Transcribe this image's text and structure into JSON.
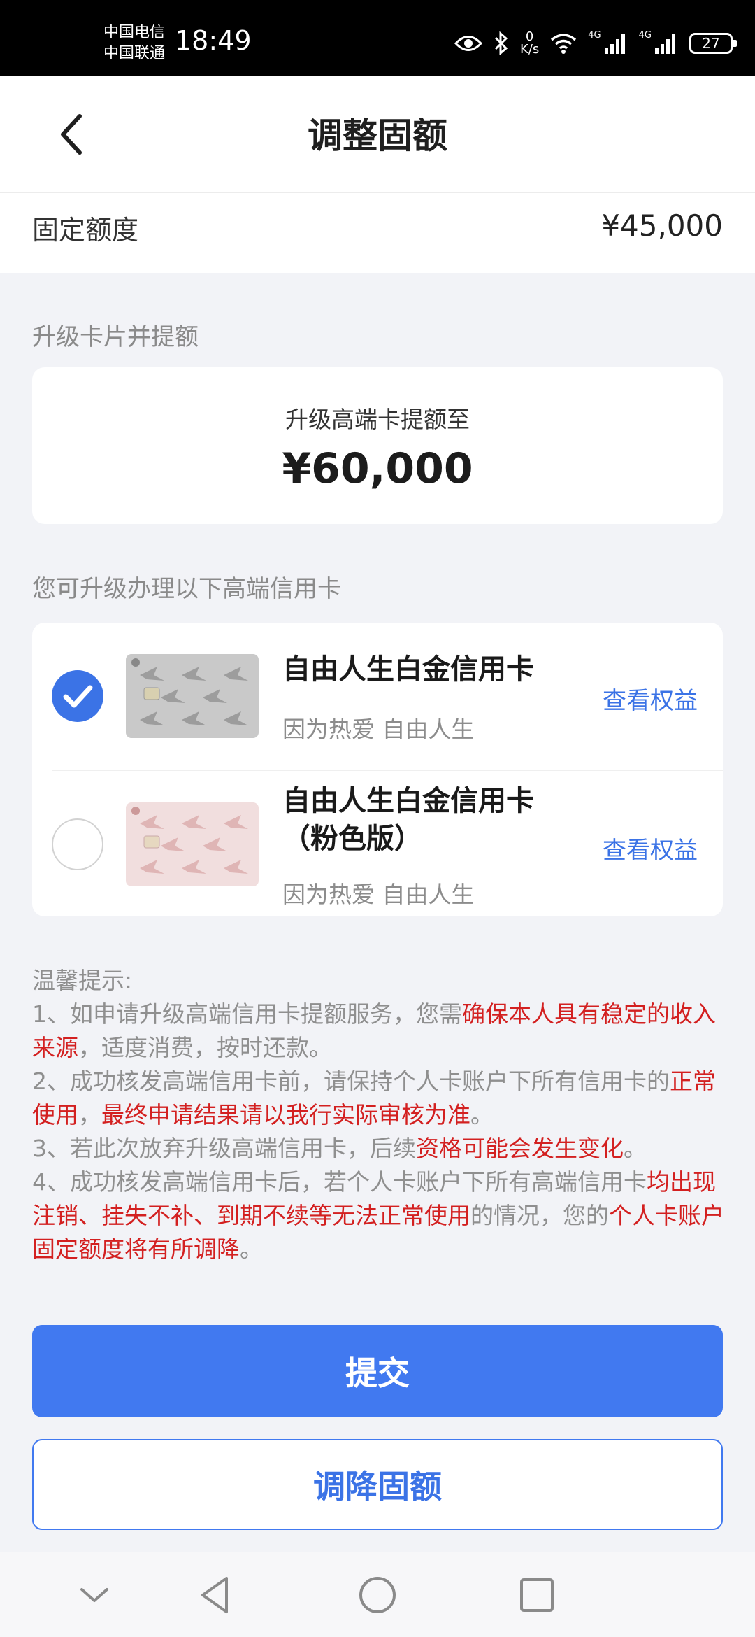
{
  "status_bar": {
    "carrier_1": "中国电信",
    "carrier_2": "中国联通",
    "time": "18:49",
    "net_speed_value": "0",
    "net_speed_unit": "K/s",
    "signal_1_label": "4G",
    "signal_2_label": "4G",
    "battery": "27"
  },
  "header": {
    "title": "调整固额",
    "back_icon": "chevron-left-icon"
  },
  "fixed_limit": {
    "label": "固定额度",
    "value": "¥45,000"
  },
  "upgrade_section": {
    "label": "升级卡片并提额",
    "card_subtitle": "升级高端卡提额至",
    "card_amount": "¥60,000"
  },
  "card_section": {
    "label": "您可升级办理以下高端信用卡",
    "options": [
      {
        "name": "自由人生白金信用卡",
        "slogan": "因为热爱 自由人生",
        "link": "查看权益",
        "selected": true,
        "card_color": "#b9b9b9"
      },
      {
        "name_line1": "自由人生白金信用卡",
        "name_line2": "（粉色版）",
        "slogan": "因为热爱 自由人生",
        "link": "查看权益",
        "selected": false,
        "card_color": "#efd6d6"
      }
    ]
  },
  "tips": {
    "title": "温馨提示:",
    "t1_a": "1、如申请升级高端信用卡提额服务，您需",
    "t1_b": "确保本人具有稳定的收入来源",
    "t1_c": "，适度消费，按时还款。",
    "t2_a": "2、成功核发高端信用卡前，请保持个人卡账户下所有信用卡的",
    "t2_b": "正常使用",
    "t2_c": "，",
    "t2_d": "最终申请结果请以我行实际审核为准",
    "t2_e": "。",
    "t3_a": "3、若此次放弃升级高端信用卡，后续",
    "t3_b": "资格可能会发生变化",
    "t3_c": "。",
    "t4_a": "4、成功核发高端信用卡后，若个人卡账户下所有高端信用卡",
    "t4_b": "均出现注销、挂失不补、到期不续等无法正常使用",
    "t4_c": "的情况，您的",
    "t4_d": "个人卡账户固定额度将有所调降",
    "t4_e": "。"
  },
  "buttons": {
    "submit": "提交",
    "decrease": "调降固额"
  },
  "system_nav": {
    "items": [
      "chevron-down-icon",
      "back-triangle-icon",
      "home-circle-icon",
      "recents-square-icon"
    ]
  },
  "colors": {
    "accent": "#4179f0",
    "link": "#3b73e6",
    "highlight": "#d32020"
  }
}
